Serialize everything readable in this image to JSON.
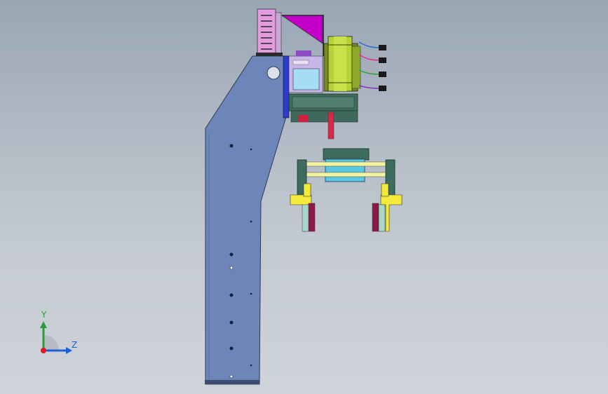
{
  "viewport": {
    "background_top": "#9aa6b4",
    "background_bottom": "#cfd4da"
  },
  "colors": {
    "arm_plate": "#6d85b8",
    "motor_body": "#b5d334",
    "gripper_block": "#5cc8e0",
    "bracket_magenta": "#c400c8",
    "finger_yellow": "#f4ea3a",
    "pad_crimson": "#8b1a45",
    "cylinder_dark": "#3d6b5c"
  },
  "triad": {
    "y_label": "Y",
    "z_label": "Z",
    "y_color": "#2a9d3a",
    "z_color": "#1f5fd6",
    "origin_color": "#e0192a"
  },
  "cables": [
    {
      "name": "cable-blue",
      "color": "#2d6bd6"
    },
    {
      "name": "cable-pink",
      "color": "#e0309a"
    },
    {
      "name": "cable-green",
      "color": "#2e9f3a"
    },
    {
      "name": "cable-purple",
      "color": "#8a2fc6"
    }
  ]
}
